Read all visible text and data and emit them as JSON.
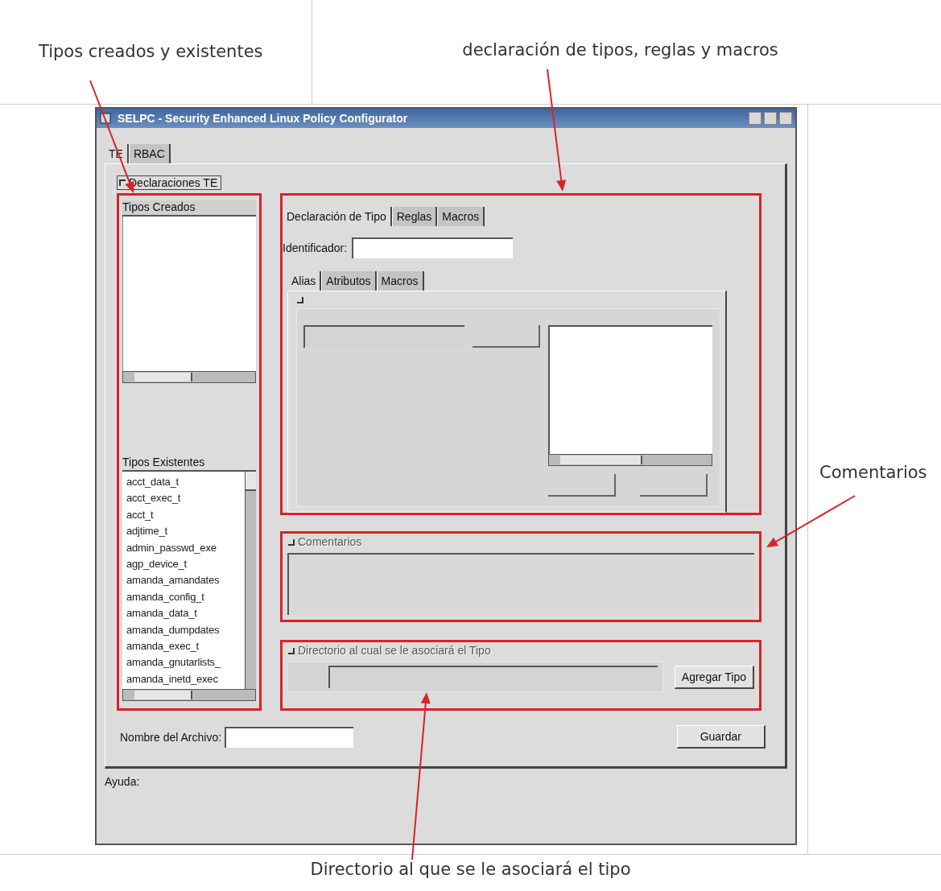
{
  "annotations": [
    {
      "text": "Tipos creados y existentes"
    },
    {
      "text": "declaración de tipos, reglas y macros"
    },
    {
      "text": "Comentarios"
    },
    {
      "text": "Directorio al que se le asociará el tipo"
    }
  ],
  "window": {
    "title": "SELPC - Security Enhanced Linux Policy Configurator"
  },
  "tabs": [
    {
      "label": "TE",
      "selected": true
    },
    {
      "label": "RBAC",
      "selected": false
    }
  ],
  "te_frame": {
    "label": "Declaraciones TE"
  },
  "created_types": {
    "label": "Tipos Creados"
  },
  "existing_types": {
    "label": "Tipos Existentes",
    "items": [
      "acct_data_t",
      "acct_exec_t",
      "acct_t",
      "adjtime_t",
      "admin_passwd_exe",
      "agp_device_t",
      "amanda_amandates",
      "amanda_config_t",
      "amanda_data_t",
      "amanda_dumpdates",
      "amanda_exec_t",
      "amanda_gnutarlists_",
      "amanda_inetd_exec"
    ]
  },
  "declaration_tabs": [
    {
      "label": "Declaración de Tipo",
      "selected": true
    },
    {
      "label": "Reglas",
      "selected": false
    },
    {
      "label": "Macros",
      "selected": false
    }
  ],
  "identifier": {
    "label": "Identificador:"
  },
  "sub_tabs": [
    {
      "label": "Alias",
      "selected": true
    },
    {
      "label": "Atributos",
      "selected": false
    },
    {
      "label": "Macros",
      "selected": false
    }
  ],
  "comments": {
    "label": "Comentarios",
    "disabled": true
  },
  "directory": {
    "label": "Directorio al cual se le asociará el Tipo",
    "disabled": true,
    "button": "Agregar Tipo"
  },
  "file_name": {
    "label": "Nombre del Archivo:"
  },
  "save_button": "Guardar",
  "help": {
    "label": "Ayuda:"
  }
}
